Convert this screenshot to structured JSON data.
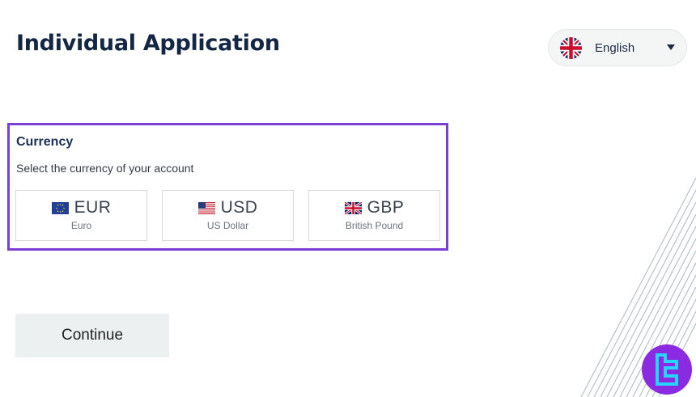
{
  "header": {
    "title": "Individual Application"
  },
  "language": {
    "selected": "English",
    "flag_icon": "uk-flag-icon"
  },
  "currency": {
    "heading": "Currency",
    "subtitle": "Select the currency of your account",
    "options": [
      {
        "code": "EUR",
        "name": "Euro",
        "flag_icon": "eu-flag-icon"
      },
      {
        "code": "USD",
        "name": "US Dollar",
        "flag_icon": "us-flag-icon"
      },
      {
        "code": "GBP",
        "name": "British Pound",
        "flag_icon": "uk-flag-icon"
      }
    ]
  },
  "actions": {
    "continue_label": "Continue"
  },
  "colors": {
    "highlight": "#7b3fd6",
    "title": "#132644",
    "logo": "#8a2be2"
  }
}
